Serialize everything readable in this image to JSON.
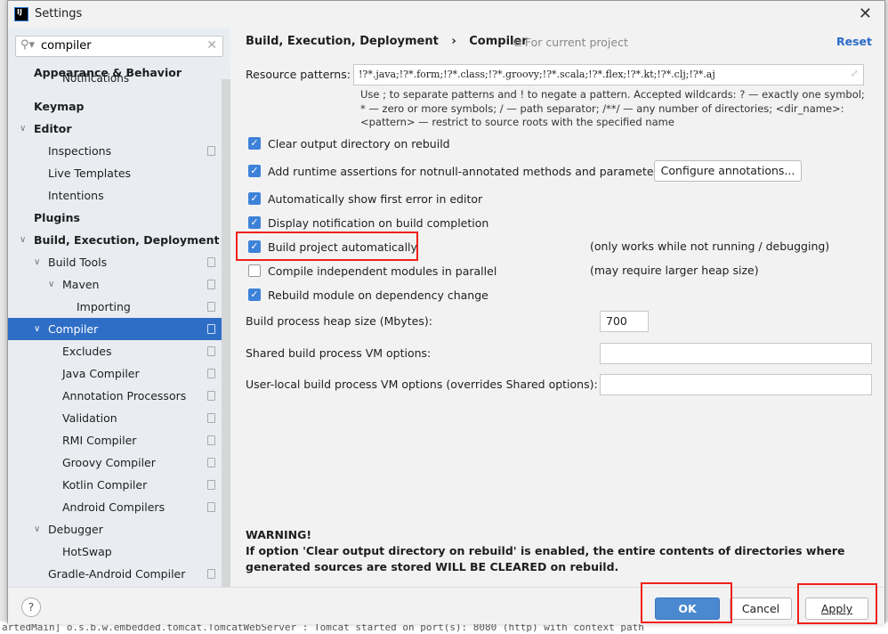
{
  "window": {
    "title": "Settings",
    "app_icon": "IJ"
  },
  "background_log": "artedMain] o.s.b.w.embedded.tomcat.TomcatWebServer  : Tomcat started on port(s): 8080 (http) with context path",
  "search": {
    "value": "compiler"
  },
  "tree": [
    {
      "label": "Appearance & Behavior",
      "level": 0,
      "bold": true
    },
    {
      "label": "Notifications",
      "level": 2,
      "clipped": true
    },
    {
      "label": "Keymap",
      "level": 0,
      "bold": true
    },
    {
      "label": "Editor",
      "level": 0,
      "bold": true,
      "expanded": true
    },
    {
      "label": "Inspections",
      "level": 1,
      "copy": true
    },
    {
      "label": "Live Templates",
      "level": 1
    },
    {
      "label": "Intentions",
      "level": 1
    },
    {
      "label": "Plugins",
      "level": 0,
      "bold": true
    },
    {
      "label": "Build, Execution, Deployment",
      "level": 0,
      "bold": true,
      "expanded": true
    },
    {
      "label": "Build Tools",
      "level": 1,
      "expanded": true,
      "copy": true
    },
    {
      "label": "Maven",
      "level": 2,
      "expanded": true,
      "copy": true
    },
    {
      "label": "Importing",
      "level": 3,
      "copy": true
    },
    {
      "label": "Compiler",
      "level": 1,
      "expanded": true,
      "copy": true,
      "selected": true
    },
    {
      "label": "Excludes",
      "level": 2,
      "copy": true
    },
    {
      "label": "Java Compiler",
      "level": 2,
      "copy": true
    },
    {
      "label": "Annotation Processors",
      "level": 2,
      "copy": true
    },
    {
      "label": "Validation",
      "level": 2,
      "copy": true
    },
    {
      "label": "RMI Compiler",
      "level": 2,
      "copy": true
    },
    {
      "label": "Groovy Compiler",
      "level": 2,
      "copy": true
    },
    {
      "label": "Kotlin Compiler",
      "level": 2,
      "copy": true
    },
    {
      "label": "Android Compilers",
      "level": 2,
      "copy": true
    },
    {
      "label": "Debugger",
      "level": 1,
      "expanded": true
    },
    {
      "label": "HotSwap",
      "level": 2
    },
    {
      "label": "Gradle-Android Compiler",
      "level": 1,
      "copy": true
    }
  ],
  "header": {
    "breadcrumb": [
      "Build, Execution, Deployment",
      "›",
      "Compiler"
    ],
    "scope": "For current project",
    "reset": "Reset"
  },
  "resource_patterns": {
    "label": "Resource patterns:",
    "value": "!?*.java;!?*.form;!?*.class;!?*.groovy;!?*.scala;!?*.flex;!?*.kt;!?*.clj;!?*.aj",
    "hint": "Use ; to separate patterns and ! to negate a pattern. Accepted wildcards: ? — exactly one symbol; * — zero or more symbols; / — path separator; /**/ — any number of directories; <dir_name>:<pattern> — restrict to source roots with the specified name"
  },
  "options": [
    {
      "label": "Clear output directory on rebuild",
      "checked": true
    },
    {
      "label": "Add runtime assertions for notnull-annotated methods and parameters",
      "checked": true
    },
    {
      "label": "Automatically show first error in editor",
      "checked": true
    },
    {
      "label": "Display notification on build completion",
      "checked": true
    },
    {
      "label": "Build project automatically",
      "checked": true,
      "note": "(only works while not running / debugging)"
    },
    {
      "label": "Compile independent modules in parallel",
      "checked": false,
      "note": "(may require larger heap size)"
    },
    {
      "label": "Rebuild module on dependency change",
      "checked": true
    }
  ],
  "configure_annotations": "Configure annotations...",
  "fields": [
    {
      "label": "Build process heap size (Mbytes):",
      "value": "700"
    },
    {
      "label": "Shared build process VM options:",
      "value": ""
    },
    {
      "label": "User-local build process VM options (overrides Shared options):",
      "value": ""
    }
  ],
  "warning": {
    "title": "WARNING!",
    "text": "If option 'Clear output directory on rebuild' is enabled, the entire contents of directories where generated sources are stored WILL BE CLEARED on rebuild."
  },
  "footer": {
    "help": "?",
    "ok": "OK",
    "cancel": "Cancel",
    "apply": "Apply"
  },
  "annotations": {
    "highlight_color": "#f0201a",
    "targets": [
      "Build project automatically",
      "OK",
      "Apply"
    ]
  },
  "colors": {
    "accent": "#2f6ec6",
    "ok_button": "#4a88cf"
  }
}
